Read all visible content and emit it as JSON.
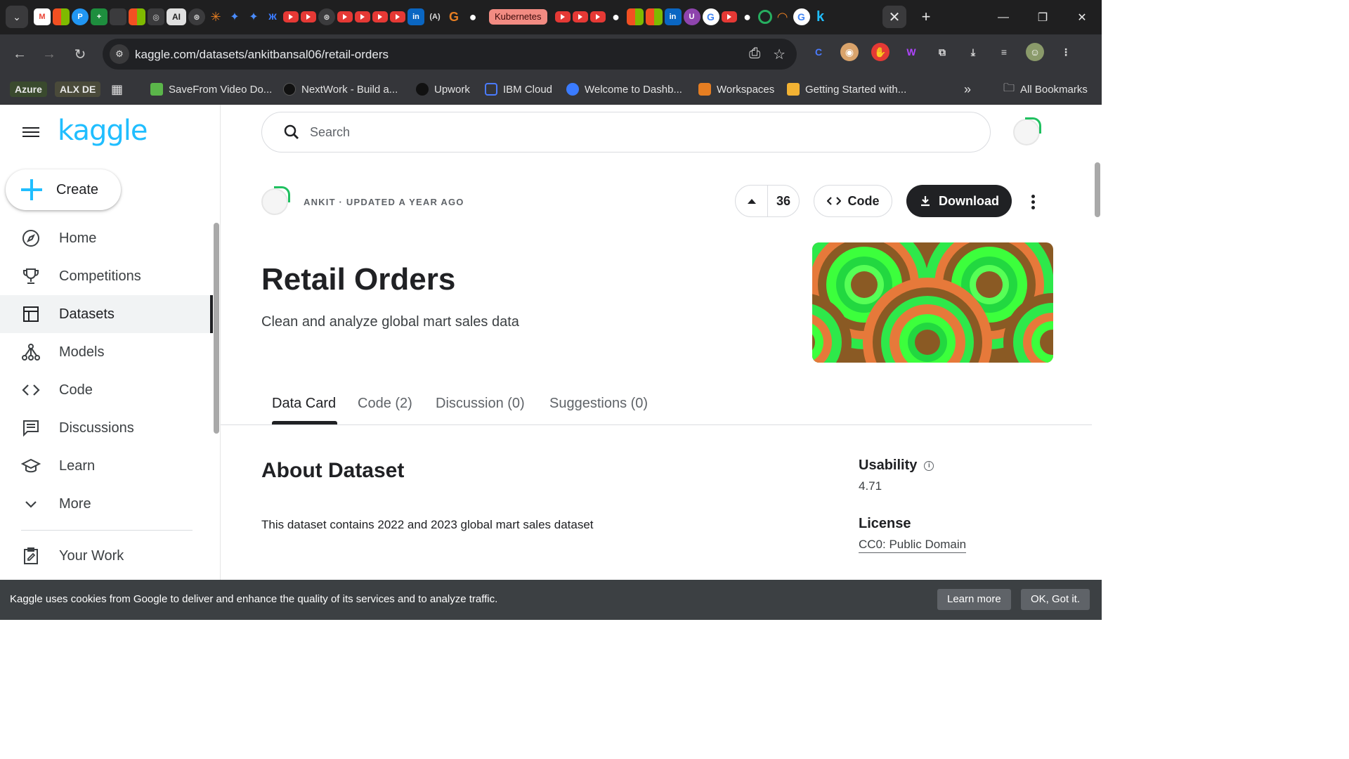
{
  "browser": {
    "kubernetes_tab": "Kubernetes",
    "ai_tab": "AI",
    "url": "kaggle.com/datasets/ankitbansal06/retail-orders",
    "bookmarks": [
      {
        "label": "Azure",
        "color": "#3b5a2a"
      },
      {
        "label": "ALX DE",
        "color": "#3b4a2a"
      },
      {
        "label": "SaveFrom Video Do..."
      },
      {
        "label": "NextWork - Build a..."
      },
      {
        "label": "Upwork"
      },
      {
        "label": "IBM Cloud"
      },
      {
        "label": "Welcome to Dashb..."
      },
      {
        "label": "Workspaces"
      },
      {
        "label": "Getting Started with..."
      }
    ],
    "all_bookmarks": "All Bookmarks",
    "more_bookmarks": "»"
  },
  "sidebar": {
    "logo": "kaggle",
    "create_label": "Create",
    "items": [
      {
        "label": "Home",
        "icon": "compass-icon"
      },
      {
        "label": "Competitions",
        "icon": "trophy-icon"
      },
      {
        "label": "Datasets",
        "icon": "table-icon",
        "active": true
      },
      {
        "label": "Models",
        "icon": "models-icon"
      },
      {
        "label": "Code",
        "icon": "code-icon"
      },
      {
        "label": "Discussions",
        "icon": "comments-icon"
      },
      {
        "label": "Learn",
        "icon": "school-icon"
      },
      {
        "label": "More",
        "icon": "chevron-down-icon"
      }
    ],
    "your_work": "Your Work"
  },
  "search": {
    "placeholder": "Search"
  },
  "dataset": {
    "meta": "ANKIT · UPDATED A YEAR AGO",
    "votes": "36",
    "code_label": "Code",
    "download_label": "Download",
    "title": "Retail Orders",
    "subtitle": "Clean and analyze global mart sales data"
  },
  "tabs": [
    {
      "label": "Data Card",
      "active": true
    },
    {
      "label": "Code (2)"
    },
    {
      "label": "Discussion (0)"
    },
    {
      "label": "Suggestions (0)"
    }
  ],
  "about": {
    "heading": "About Dataset",
    "description": "This dataset contains 2022 and 2023 global mart sales dataset"
  },
  "sidebar_meta": {
    "usability_label": "Usability",
    "usability_value": "4.71",
    "license_label": "License",
    "license_value": "CC0: Public Domain"
  },
  "cookie": {
    "text": "Kaggle uses cookies from Google to deliver and enhance the quality of its services and to analyze traffic.",
    "learn_more": "Learn more",
    "ok": "OK, Got it."
  },
  "colors": {
    "kaggle_blue": "#20beff",
    "dark": "#202124"
  }
}
